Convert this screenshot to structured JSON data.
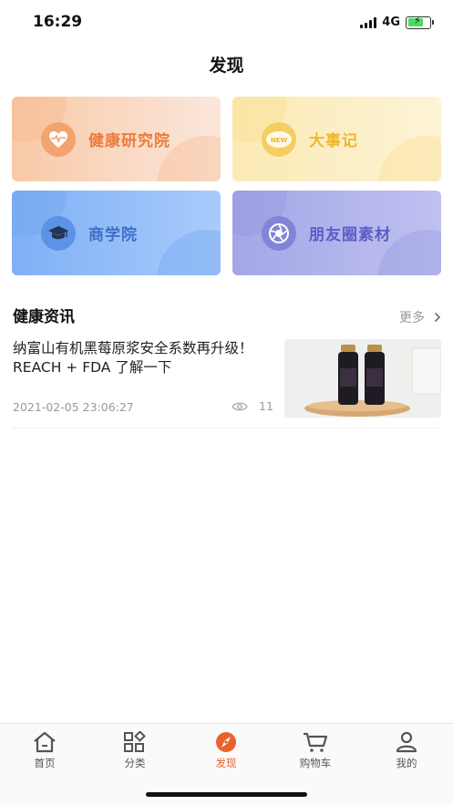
{
  "status_bar": {
    "time": "16:29",
    "network": "4G"
  },
  "header": {
    "title": "发现"
  },
  "tiles": [
    {
      "label": "健康研究院",
      "icon": "heart-pulse-icon"
    },
    {
      "label": "大事记",
      "icon": "new-badge-icon",
      "icon_text": "NEW"
    },
    {
      "label": "商学院",
      "icon": "graduation-cap-icon"
    },
    {
      "label": "朋友圈素材",
      "icon": "aperture-icon"
    }
  ],
  "news": {
    "title": "健康资讯",
    "more_label": "更多",
    "articles": [
      {
        "title": "纳富山有机黑莓原浆安全系数再升级！REACH + FDA 了解一下",
        "date": "2021-02-05 23:06:27",
        "views": "11"
      }
    ]
  },
  "tabbar": {
    "items": [
      {
        "label": "首页",
        "icon": "home-icon"
      },
      {
        "label": "分类",
        "icon": "category-grid-icon"
      },
      {
        "label": "发现",
        "icon": "compass-icon",
        "active": true
      },
      {
        "label": "购物车",
        "icon": "cart-icon"
      },
      {
        "label": "我的",
        "icon": "user-icon"
      }
    ]
  },
  "colors": {
    "accent": "#e8632c",
    "tile_orange": "#ec7b3d",
    "tile_yellow": "#f0b52e",
    "tile_blue": "#3f6fc9",
    "tile_purple": "#5b5ec6"
  }
}
